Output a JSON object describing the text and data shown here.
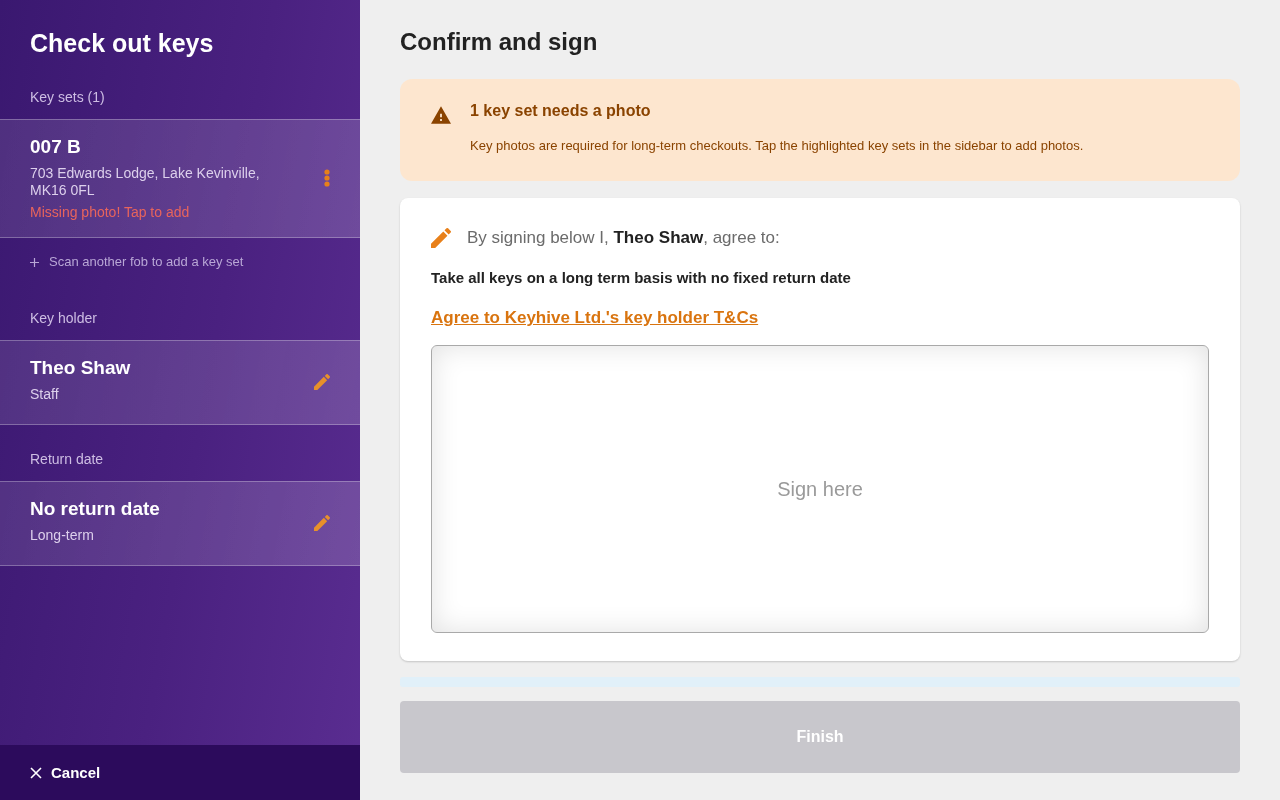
{
  "sidebar": {
    "title": "Check out keys",
    "sections": [
      {
        "label": "Key sets (1)",
        "cards": [
          {
            "kind": "menu",
            "title": "007 B",
            "subtitle": "703 Edwards Lodge, Lake Kevinville, MK16 0FL",
            "warning": "Missing photo! Tap to add"
          }
        ],
        "add_link": "Scan another fob to add a key set"
      },
      {
        "label": "Key holder",
        "cards": [
          {
            "kind": "edit",
            "title": "Theo Shaw",
            "subtitle": "Staff"
          }
        ]
      },
      {
        "label": "Return date",
        "cards": [
          {
            "kind": "edit",
            "title": "No return date",
            "subtitle": "Long-term"
          }
        ]
      }
    ],
    "cancel_button": "Cancel"
  },
  "main": {
    "heading": "Confirm and sign",
    "alert": {
      "kind": "warning",
      "title": "1 key set needs a photo",
      "message": "Key photos are required for long-term checkouts. Tap the highlighted key sets in the sidebar to add photos."
    },
    "agreement": {
      "intro": "By signing below I, **Theo Shaw**, agree to:",
      "terms": "Take all keys on a long term basis with no fixed return date",
      "link": "Agree to Keyhive Ltd.'s key holder T&Cs",
      "signature_placeholder": "Sign here"
    },
    "finish_button": {
      "label": "Finish",
      "disabled": true
    }
  }
}
